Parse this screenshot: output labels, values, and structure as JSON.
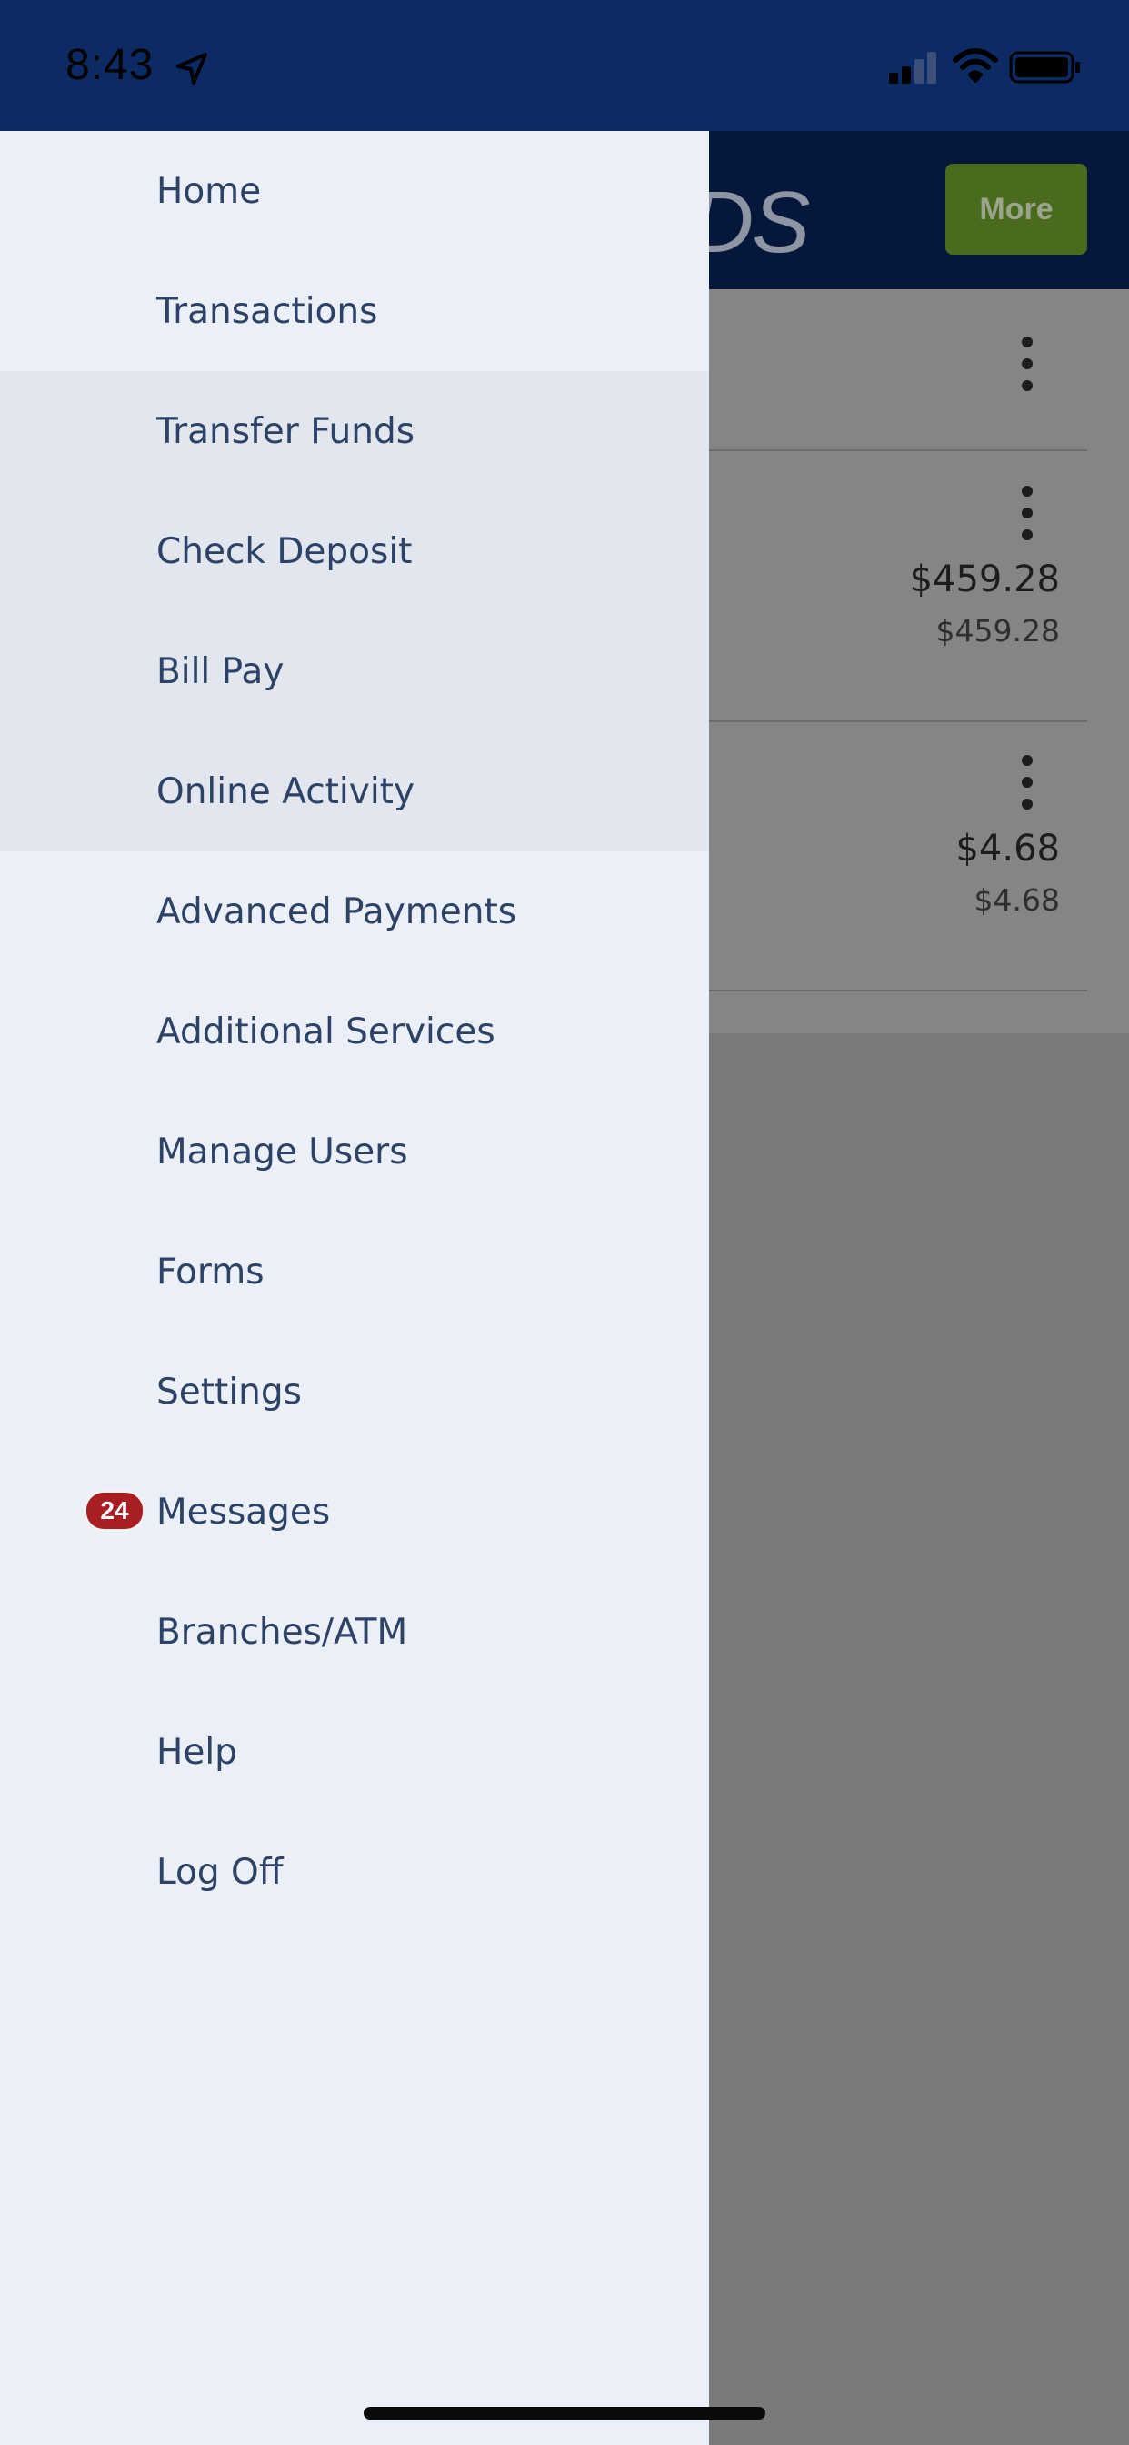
{
  "status_bar": {
    "time": "8:43",
    "icons": [
      "location-arrow-icon",
      "cellular-signal-icon",
      "wifi-icon",
      "battery-icon"
    ]
  },
  "background_app": {
    "logo_fragment": "DS",
    "more_label": "More",
    "accounts": [
      {
        "amount": "$459.28",
        "sub_amount": "$459.28"
      },
      {
        "amount": "$4.68",
        "sub_amount": "$4.68"
      }
    ]
  },
  "drawer": {
    "items": [
      {
        "label": "Home"
      },
      {
        "label": "Transactions"
      },
      {
        "label": "Transfer Funds"
      },
      {
        "label": "Check Deposit"
      },
      {
        "label": "Bill Pay"
      },
      {
        "label": "Online Activity"
      },
      {
        "label": "Advanced Payments"
      },
      {
        "label": "Additional Services"
      },
      {
        "label": "Manage Users"
      },
      {
        "label": "Forms"
      },
      {
        "label": "Settings"
      },
      {
        "label": "Messages",
        "badge": "24"
      },
      {
        "label": "Branches/ATM"
      },
      {
        "label": "Help"
      },
      {
        "label": "Log Off"
      }
    ]
  },
  "colors": {
    "status_bar": "#0c2a63",
    "drawer_bg": "#ebf0f8",
    "menu_text": "#2e4266",
    "badge": "#a91e23",
    "more_button": "#4a6a1e"
  }
}
